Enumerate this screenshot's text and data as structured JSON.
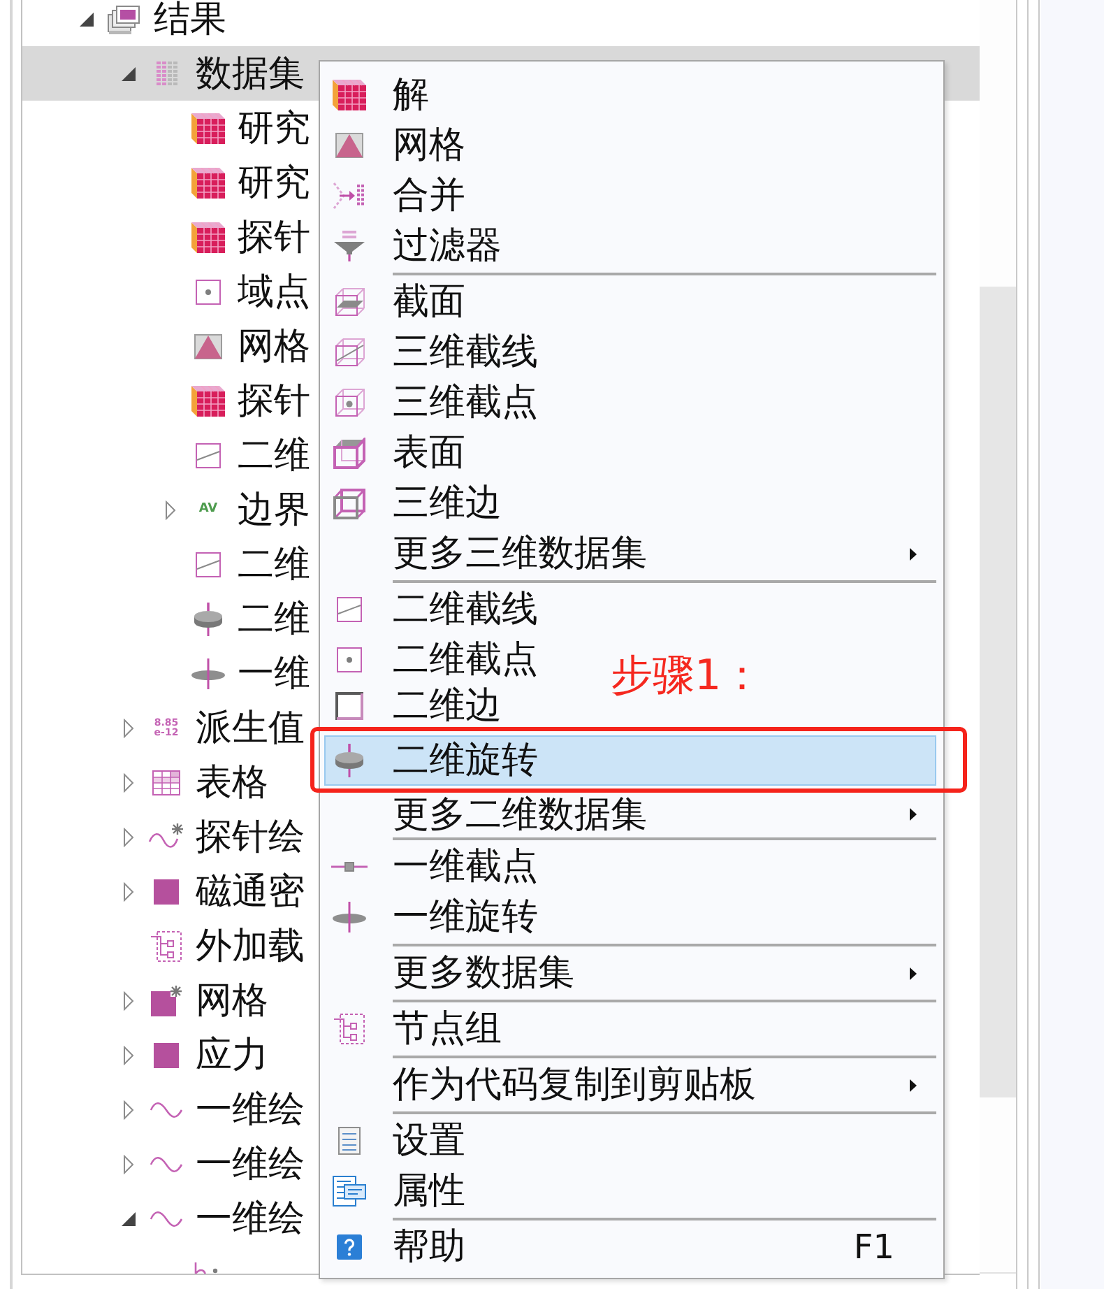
{
  "tree": {
    "items": [
      {
        "label": "结果",
        "kind": "results",
        "expanded": true,
        "selected": false,
        "children": [
          {
            "label": "数据集",
            "kind": "datasets",
            "expanded": true,
            "selected": true,
            "children": [
              {
                "label": "研究",
                "kind": "solution",
                "selected": false
              },
              {
                "label": "研究",
                "kind": "solution",
                "selected": false
              },
              {
                "label": "探针",
                "kind": "solution",
                "selected": false
              },
              {
                "label": "域点",
                "kind": "point2d",
                "selected": false
              },
              {
                "label": "网格",
                "kind": "mesh",
                "selected": false
              },
              {
                "label": "探针",
                "kind": "solution",
                "selected": false
              },
              {
                "label": "二维",
                "kind": "cutline2d",
                "selected": false
              },
              {
                "label": "边界",
                "kind": "evaluation",
                "icon_text": [
                  "AV"
                ],
                "expanded": false,
                "selected": false
              },
              {
                "label": "二维",
                "kind": "cutline2d",
                "selected": false
              },
              {
                "label": "二维",
                "kind": "revolve2d",
                "selected": false
              },
              {
                "label": "一维",
                "kind": "revolve1d",
                "selected": false
              }
            ]
          },
          {
            "label": "派生值",
            "kind": "derived",
            "icon_text": [
              "8.85",
              "e-12"
            ],
            "expanded": false,
            "selected": false
          },
          {
            "label": "表格",
            "kind": "table",
            "expanded": false,
            "selected": false
          },
          {
            "label": "探针绘",
            "kind": "probeplot",
            "expanded": false,
            "selected": false
          },
          {
            "label": "磁通密",
            "kind": "plotgroup",
            "expanded": false,
            "selected": false
          },
          {
            "label": "外加载",
            "kind": "nodegroup",
            "selected": false
          },
          {
            "label": "网格",
            "kind": "meshplot",
            "expanded": false,
            "selected": false
          },
          {
            "label": "应力",
            "kind": "plotgroup",
            "expanded": false,
            "selected": false
          },
          {
            "label": "一维绘",
            "kind": "wave",
            "expanded": false,
            "selected": false
          },
          {
            "label": "一维绘",
            "kind": "wave",
            "expanded": false,
            "selected": false
          },
          {
            "label": "一维绘",
            "kind": "wave",
            "expanded": true,
            "selected": false,
            "children": [
              {
                "kind": "pointgraph",
                "selected": false
              }
            ]
          }
        ]
      }
    ]
  },
  "context_menu": {
    "groups": [
      [
        {
          "label": "解",
          "kind": "solution",
          "submenu": false,
          "selected": false
        },
        {
          "label": "网格",
          "kind": "mesh",
          "submenu": false,
          "selected": false
        },
        {
          "label": "合并",
          "kind": "join",
          "submenu": false,
          "selected": false
        },
        {
          "label": "过滤器",
          "kind": "filter",
          "submenu": false,
          "selected": false
        }
      ],
      [
        {
          "label": "截面",
          "kind": "cutplane",
          "submenu": false,
          "selected": false
        },
        {
          "label": "三维截线",
          "kind": "cutline3d",
          "submenu": false,
          "selected": false
        },
        {
          "label": "三维截点",
          "kind": "cutpoint3d",
          "submenu": false,
          "selected": false
        },
        {
          "label": "表面",
          "kind": "surface",
          "submenu": false,
          "selected": false
        },
        {
          "label": "三维边",
          "kind": "edge3d",
          "submenu": false,
          "selected": false
        },
        {
          "label": "更多三维数据集",
          "kind": "plain",
          "submenu": true,
          "selected": false
        }
      ],
      [
        {
          "label": "二维截线",
          "kind": "cutline2d",
          "submenu": false,
          "selected": false
        },
        {
          "label": "二维截点",
          "kind": "point2d",
          "submenu": false,
          "selected": false
        },
        {
          "label": "二维边",
          "kind": "edge2d",
          "submenu": false,
          "selected": false
        },
        {
          "label": "二维旋转",
          "kind": "revolve2d",
          "submenu": false,
          "selected": true,
          "callout": "步骤1："
        },
        {
          "label": "更多二维数据集",
          "kind": "plain",
          "submenu": true,
          "selected": false
        }
      ],
      [
        {
          "label": "一维截点",
          "kind": "cutpoint1d",
          "submenu": false,
          "selected": false
        },
        {
          "label": "一维旋转",
          "kind": "revolve1d",
          "submenu": false,
          "selected": false
        }
      ],
      [
        {
          "label": "更多数据集",
          "kind": "plain",
          "submenu": true,
          "selected": false
        }
      ],
      [
        {
          "label": "节点组",
          "kind": "nodegroup",
          "submenu": false,
          "selected": false
        }
      ],
      [
        {
          "label": "作为代码复制到剪贴板",
          "kind": "plain",
          "submenu": true,
          "selected": false
        }
      ],
      [
        {
          "label": "设置",
          "kind": "settings",
          "submenu": false,
          "selected": false
        },
        {
          "label": "属性",
          "kind": "properties",
          "submenu": false,
          "selected": false
        }
      ],
      [
        {
          "label": "帮助",
          "kind": "help",
          "submenu": false,
          "selected": false,
          "shortcut": "F1"
        }
      ]
    ]
  }
}
